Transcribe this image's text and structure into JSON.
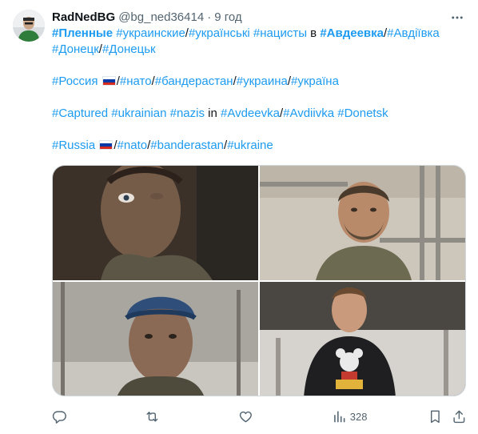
{
  "tweet": {
    "author": {
      "name": "RadNedBG",
      "handle": "@bg_ned36414",
      "separator": "·",
      "time": "9 год"
    },
    "lines": {
      "l1": [
        {
          "t": "#Пленные",
          "tag": true,
          "bold": true
        },
        {
          "t": " ",
          "tag": false
        },
        {
          "t": "#украинские",
          "tag": true
        },
        {
          "t": "/",
          "tag": false
        },
        {
          "t": "#українські",
          "tag": true
        },
        {
          "t": " ",
          "tag": false
        },
        {
          "t": "#нацисты",
          "tag": true
        },
        {
          "t": " в ",
          "tag": false
        },
        {
          "t": "#Авдеевка",
          "tag": true,
          "bold": true
        },
        {
          "t": "/",
          "tag": false
        },
        {
          "t": "#Авдіївка",
          "tag": true
        }
      ],
      "l2": [
        {
          "t": "#Донецк",
          "tag": true
        },
        {
          "t": "/",
          "tag": false
        },
        {
          "t": "#Донецьк",
          "tag": true
        }
      ],
      "l3a": [
        {
          "t": "#Россия",
          "tag": true
        },
        {
          "t": " ",
          "tag": false
        }
      ],
      "l3b": [
        {
          "t": "/",
          "tag": false
        },
        {
          "t": "#нато",
          "tag": true
        },
        {
          "t": "/",
          "tag": false
        },
        {
          "t": "#бандерастан",
          "tag": true
        },
        {
          "t": "/",
          "tag": false
        },
        {
          "t": "#украина",
          "tag": true
        },
        {
          "t": "/",
          "tag": false
        },
        {
          "t": "#україна",
          "tag": true
        }
      ],
      "l4": [
        {
          "t": "#Captured",
          "tag": true
        },
        {
          "t": " ",
          "tag": false
        },
        {
          "t": "#ukrainian",
          "tag": true
        },
        {
          "t": " ",
          "tag": false
        },
        {
          "t": "#nazis",
          "tag": true
        },
        {
          "t": " in ",
          "tag": false
        },
        {
          "t": "#Avdeevka",
          "tag": true
        },
        {
          "t": "/",
          "tag": false
        },
        {
          "t": "#Avdiivka",
          "tag": true
        },
        {
          "t": " ",
          "tag": false
        },
        {
          "t": "#Donetsk",
          "tag": true
        }
      ],
      "l5a": [
        {
          "t": "#Russia",
          "tag": true
        },
        {
          "t": " ",
          "tag": false
        }
      ],
      "l5b": [
        {
          "t": "/",
          "tag": false
        },
        {
          "t": "#nato",
          "tag": true
        },
        {
          "t": "/",
          "tag": false
        },
        {
          "t": "#banderastan",
          "tag": true
        },
        {
          "t": "/",
          "tag": false
        },
        {
          "t": "#ukraine",
          "tag": true
        }
      ]
    },
    "flag_colors": [
      "#ffffff",
      "#0039a6",
      "#d52b1e"
    ],
    "link_color": "#1d9bf0",
    "stats": {
      "views": "328"
    }
  }
}
